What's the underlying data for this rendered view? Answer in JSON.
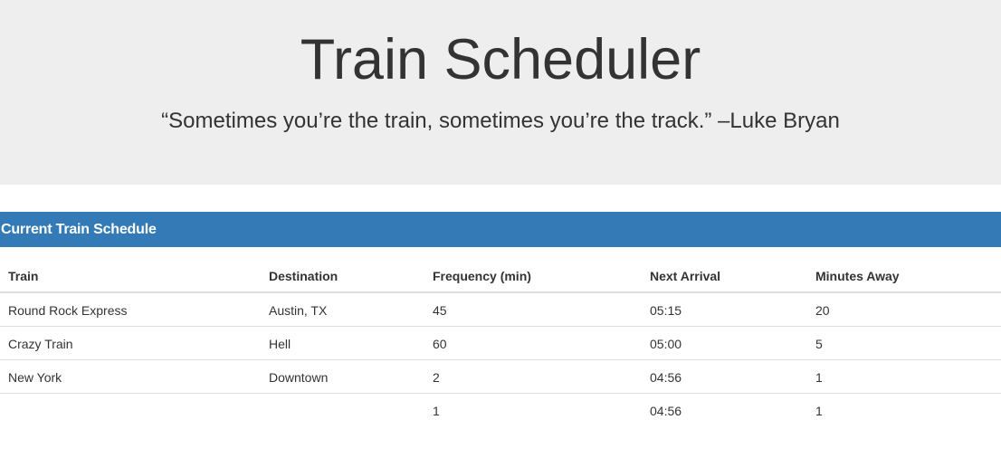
{
  "header": {
    "title": "Train Scheduler",
    "quote": "“Sometimes you’re the train, sometimes you’re the track.” –Luke Bryan"
  },
  "panel": {
    "heading": "Current Train Schedule"
  },
  "table": {
    "columns": [
      "Train",
      "Destination",
      "Frequency (min)",
      "Next Arrival",
      "Minutes Away"
    ],
    "rows": [
      [
        "Round Rock Express",
        "Austin, TX",
        "45",
        "05:15",
        "20"
      ],
      [
        "Crazy Train",
        "Hell",
        "60",
        "05:00",
        "5"
      ],
      [
        "New York",
        "Downtown",
        "2",
        "04:56",
        "1"
      ],
      [
        "",
        "",
        "1",
        "04:56",
        "1"
      ]
    ]
  },
  "colors": {
    "jumbotron_bg": "#eeeeee",
    "panel_heading_bg": "#337ab7",
    "text": "#333333"
  }
}
